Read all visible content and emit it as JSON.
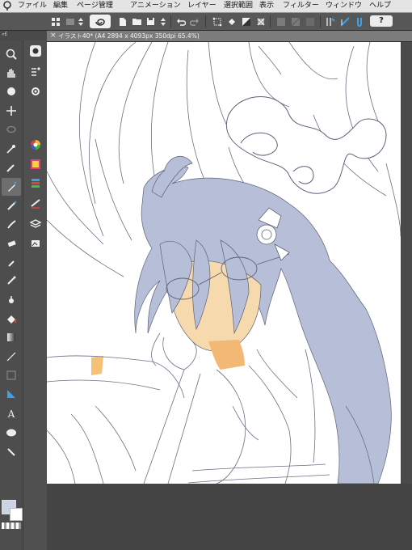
{
  "app": {
    "menu": [
      "ファイル",
      "編集",
      "ページ管理",
      "アニメーション",
      "レイヤー",
      "選択範囲",
      "表示",
      "フィルター",
      "ウィンドウ",
      "ヘルプ"
    ]
  },
  "toolbar": {
    "help_label": "?"
  },
  "panel": {
    "header_text": "«E"
  },
  "document": {
    "tab_title": "イラスト40* (A4 2894 x 4093px 350dpi 65.4%)",
    "close_glyph": "×"
  },
  "colors": {
    "hair": "#b7bed8",
    "skin": "#f6d9ad",
    "skin_shadow": "#f3b874",
    "orange": "#f5c176",
    "line": "#5d6278",
    "ui_dark": "#3c3c3c",
    "ui_panel": "#5a5a5a"
  },
  "tools": {
    "main": [
      "magnifier-icon",
      "hand-icon",
      "rotate-icon",
      "move-icon",
      "lasso-select-icon",
      "auto-select-icon",
      "eyedropper-icon",
      "pen-icon",
      "pencil-icon",
      "brush-icon",
      "eraser-icon",
      "blend-icon",
      "airbrush-icon",
      "decoration-icon",
      "fill-icon",
      "gradient-icon",
      "line-icon",
      "frame-icon",
      "ruler-icon",
      "text-icon",
      "balloon-icon",
      "correct-line-icon"
    ],
    "sub": [
      "quick-access-icon",
      "sub-tool-icon",
      "tool-property-icon",
      "color-wheel-icon",
      "color-palette-icon",
      "color-slider-icon",
      "navigator-icon",
      "layer-icon",
      "material-icon"
    ]
  }
}
